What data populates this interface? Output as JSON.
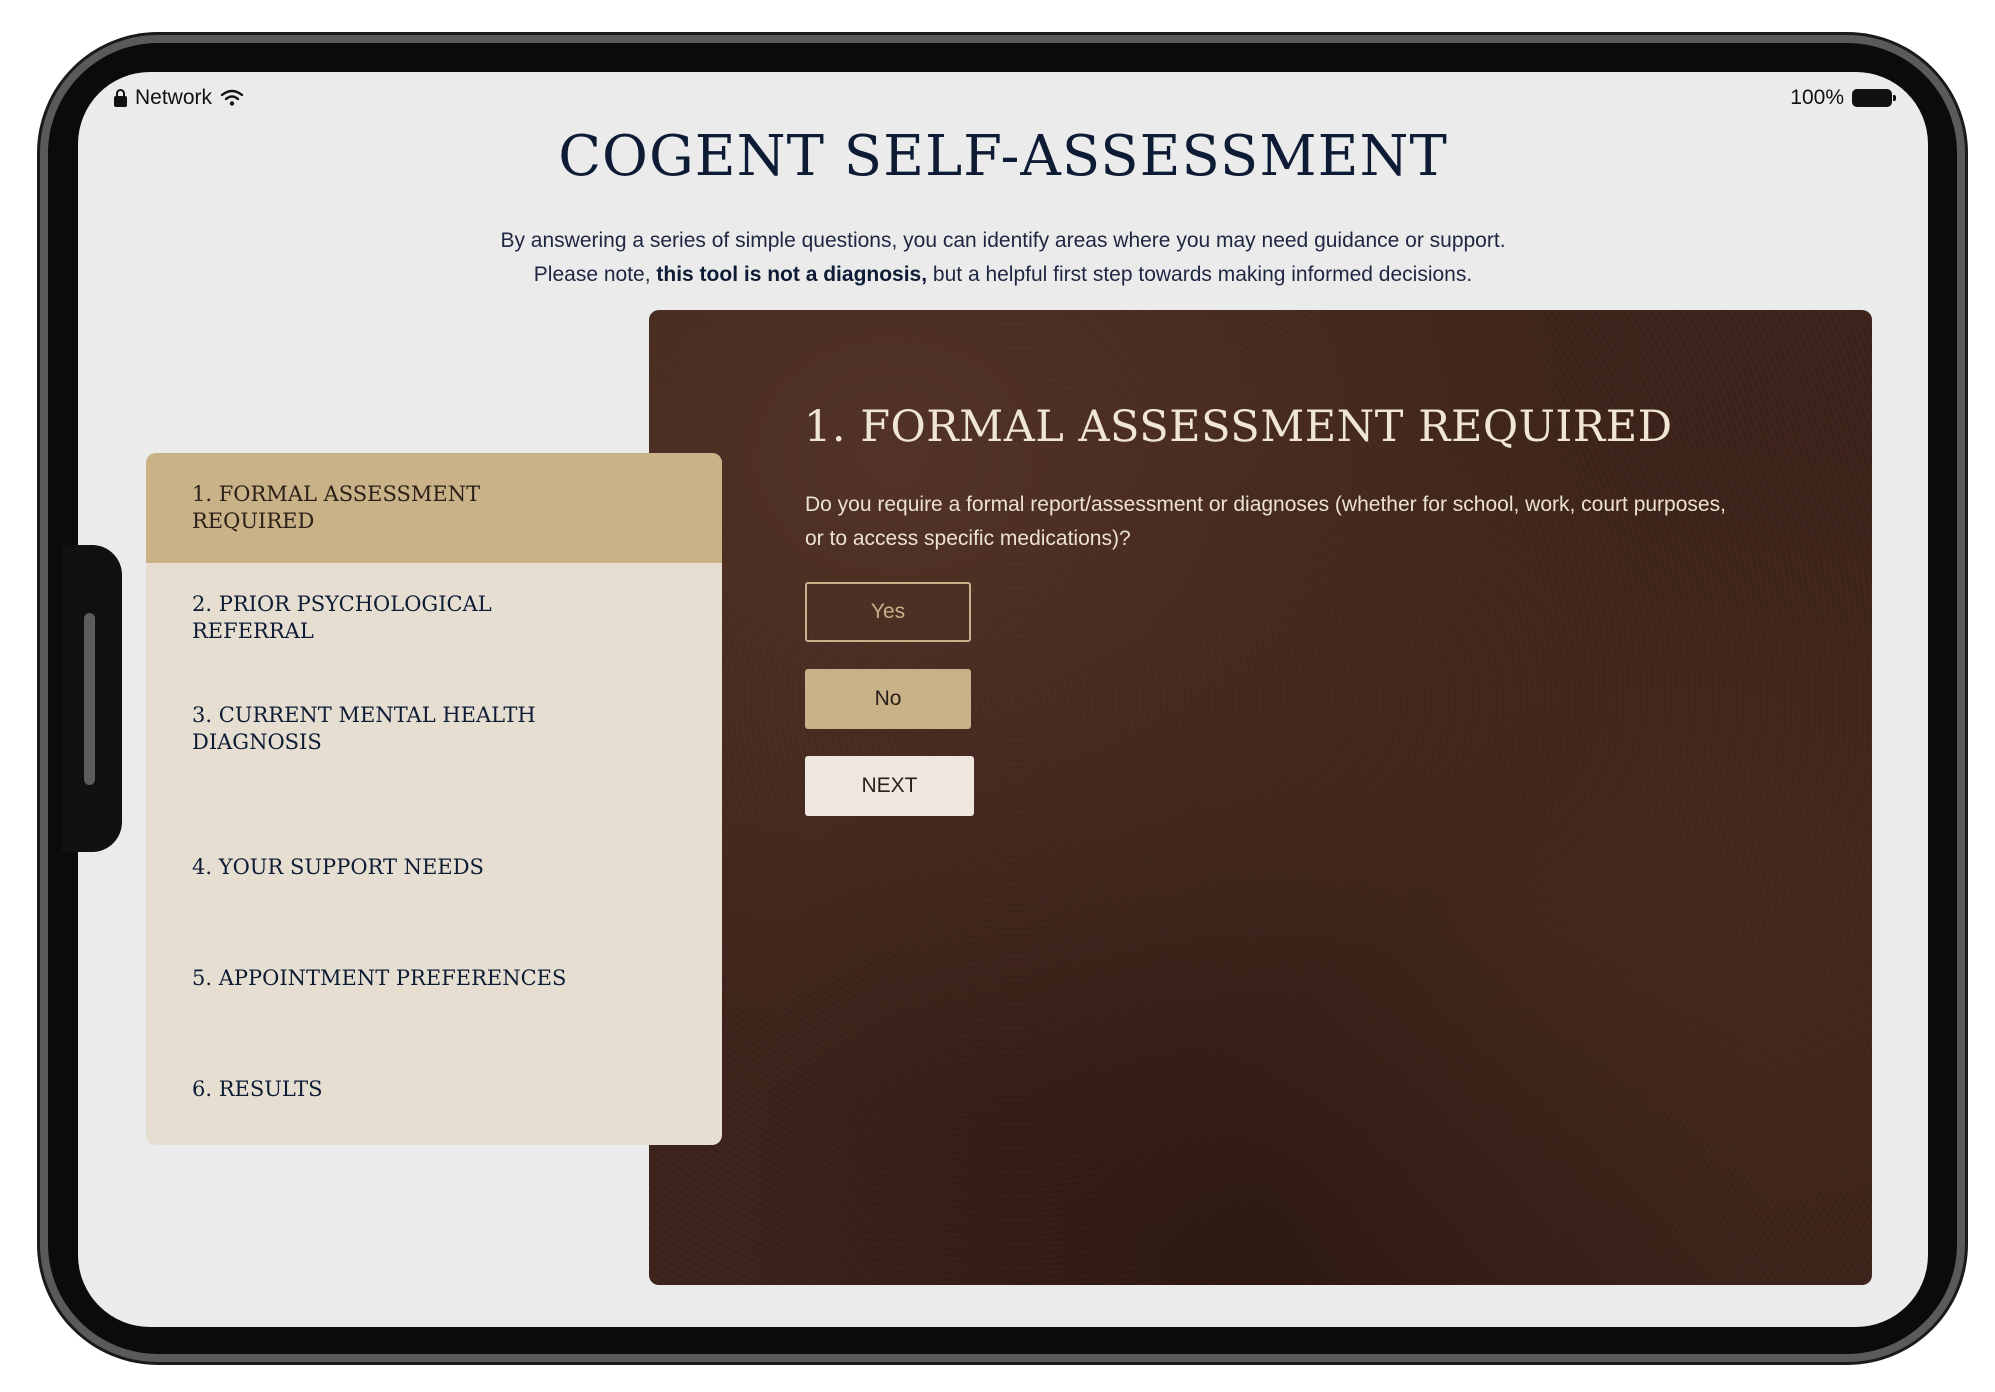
{
  "status_bar": {
    "network_label": "Network",
    "battery_label": "100%",
    "icons": [
      "lock-icon",
      "wifi-icon",
      "battery-icon"
    ]
  },
  "page": {
    "title": "COGENT SELF-ASSESSMENT",
    "intro_line1": "By answering a series of simple questions, you can identify areas where you may need guidance or support.",
    "intro_line2_prefix": "Please note, ",
    "intro_line2_bold": "this tool is not a diagnosis,",
    "intro_line2_suffix": " but a helpful first step towards making informed decisions."
  },
  "steps": {
    "active_index": 0,
    "items": [
      {
        "label": "1. FORMAL ASSESSMENT REQUIRED"
      },
      {
        "label": "2. PRIOR PSYCHOLOGICAL REFERRAL"
      },
      {
        "label": "3. CURRENT MENTAL HEALTH DIAGNOSIS"
      },
      {
        "label": "4. YOUR SUPPORT NEEDS"
      },
      {
        "label": "5. APPOINTMENT PREFERENCES"
      },
      {
        "label": "6. RESULTS"
      }
    ]
  },
  "question": {
    "heading": "1. FORMAL ASSESSMENT REQUIRED",
    "text": "Do you require a formal report/assessment or diagnoses (whether for school, work, court purposes, or to access specific medications)?",
    "options": [
      {
        "label": "Yes",
        "selected": false
      },
      {
        "label": "No",
        "selected": true
      }
    ],
    "next_label": "NEXT"
  },
  "colors": {
    "accent_tan": "#c9b188",
    "navy": "#0d1b35",
    "panel_cream": "#e6dfd1",
    "leather_brown": "#3e241b",
    "screen_bg": "#ebebeb"
  }
}
